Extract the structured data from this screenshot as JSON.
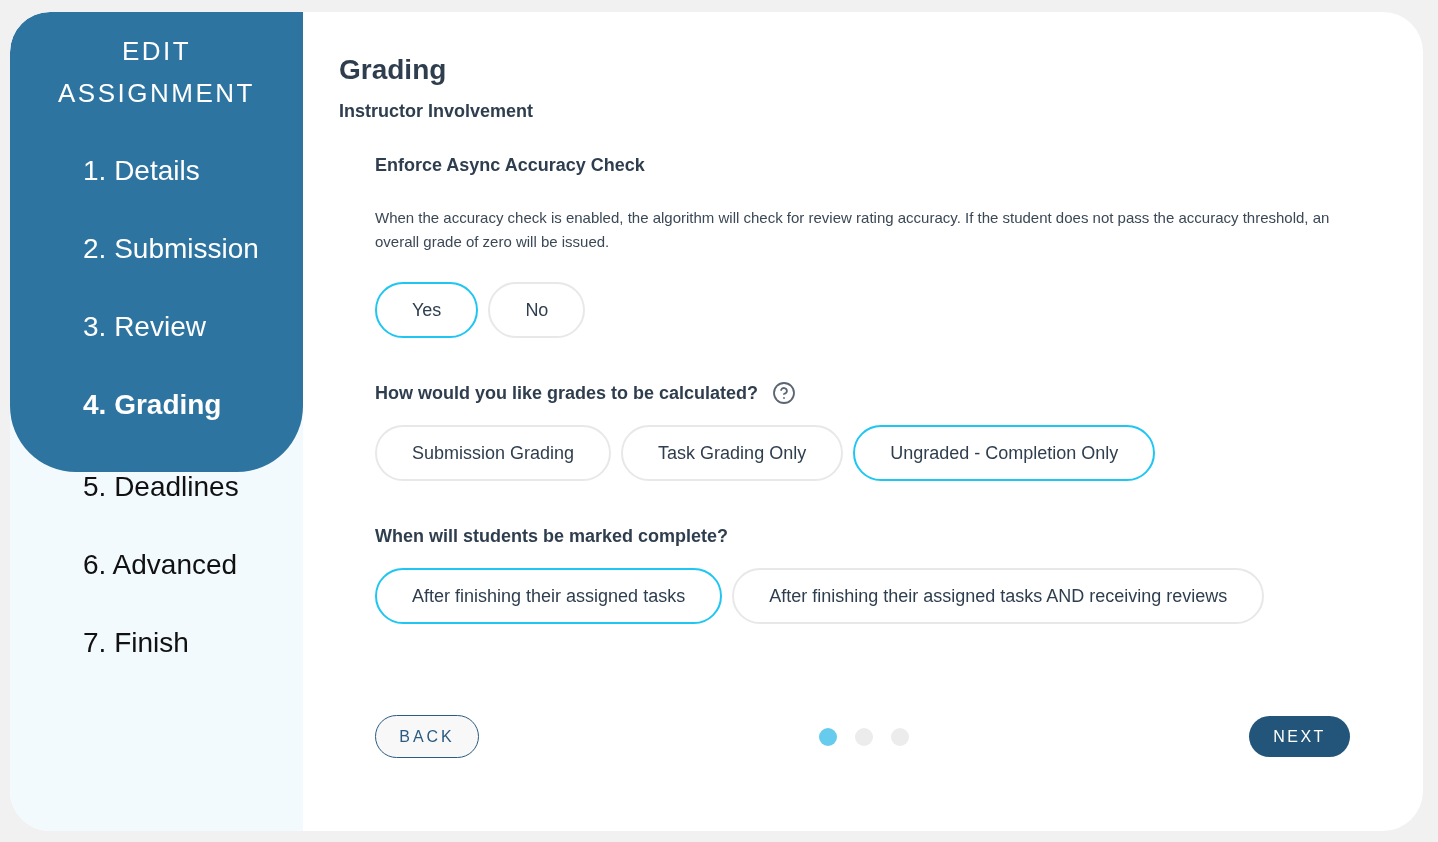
{
  "sidebar": {
    "title": "EDIT ASSIGNMENT",
    "steps": [
      {
        "label": "1. Details",
        "selected": false
      },
      {
        "label": "2. Submission",
        "selected": false
      },
      {
        "label": "3. Review",
        "selected": false
      },
      {
        "label": "4. Grading",
        "selected": true
      },
      {
        "label": "5. Deadlines",
        "selected": false
      },
      {
        "label": "6. Advanced",
        "selected": false
      },
      {
        "label": "7. Finish",
        "selected": false
      }
    ]
  },
  "main": {
    "title": "Grading",
    "section": "Instructor Involvement",
    "questions": [
      {
        "label": "Enforce Async Accuracy Check",
        "description": "When the accuracy check is enabled, the algorithm will check for review rating accuracy. If the student does not pass the accuracy threshold, an overall grade of zero will be issued.",
        "options": [
          {
            "label": "Yes",
            "selected": true
          },
          {
            "label": "No",
            "selected": false
          }
        ]
      },
      {
        "label": "How would you like grades to be calculated?",
        "help_icon": true,
        "options": [
          {
            "label": "Submission Grading",
            "selected": false
          },
          {
            "label": "Task Grading Only",
            "selected": false
          },
          {
            "label": "Ungraded - Completion Only",
            "selected": true
          }
        ]
      },
      {
        "label": "When will students be marked complete?",
        "options": [
          {
            "label": "After finishing their assigned tasks",
            "selected": true
          },
          {
            "label": "After finishing their assigned tasks AND receiving reviews",
            "selected": false
          }
        ]
      }
    ]
  },
  "footer": {
    "back": "BACK",
    "next": "NEXT",
    "pages": [
      {
        "selected": true
      },
      {
        "selected": false
      },
      {
        "selected": false
      }
    ]
  }
}
